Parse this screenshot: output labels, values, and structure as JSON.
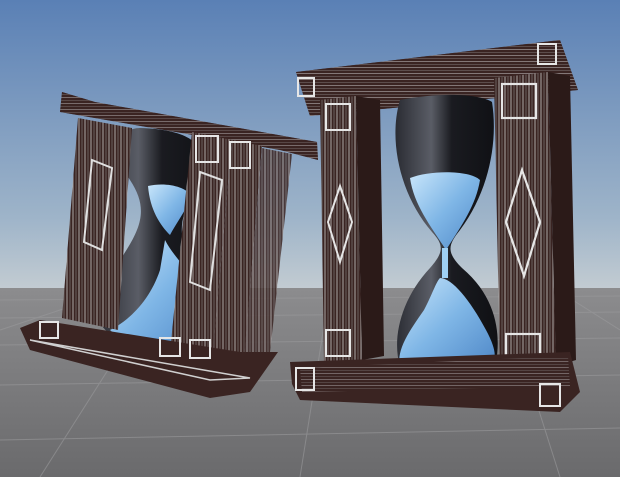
{
  "scene": {
    "sky_top": "#5d83b7",
    "sky_horizon": "#b9c4cc",
    "ground_color": "#6f6f72",
    "grid_line_color": "#8a8a8c",
    "wood_color": "#3a2422",
    "wood_highlight": "#5a3a36",
    "inlay_color": "#d8d8d8",
    "glass_color": "#1c1e24",
    "sand_color": "#8fc3ee",
    "objects": [
      {
        "name": "tilted-hourglass"
      },
      {
        "name": "upright-hourglass"
      }
    ]
  }
}
